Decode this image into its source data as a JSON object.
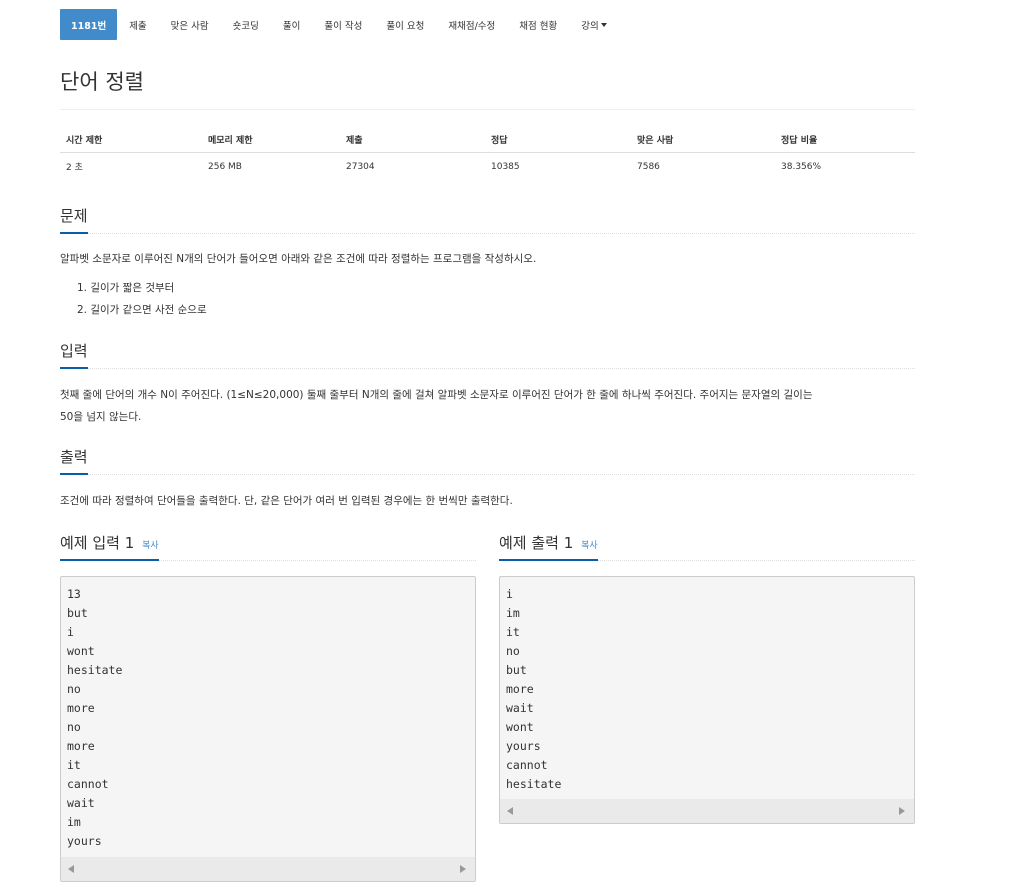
{
  "nav": {
    "items": [
      "1181번",
      "제출",
      "맞은 사람",
      "숏코딩",
      "풀이",
      "풀이 작성",
      "풀이 요청",
      "재채점/수정",
      "채점 현황",
      "강의"
    ]
  },
  "problem": {
    "title": "단어 정렬"
  },
  "stats": {
    "headers": [
      "시간 제한",
      "메모리 제한",
      "제출",
      "정답",
      "맞은 사람",
      "정답 비율"
    ],
    "values": [
      "2 초",
      "256 MB",
      "27304",
      "10385",
      "7586",
      "38.356%"
    ]
  },
  "sections": {
    "description_title": "문제",
    "description_text": "알파벳 소문자로 이루어진 N개의 단어가 들어오면 아래와 같은 조건에 따라 정렬하는 프로그램을 작성하시오.",
    "description_list": [
      "1. 길이가 짧은 것부터",
      "2. 길이가 같으면 사전 순으로"
    ],
    "input_title": "입력",
    "input_text_1": "첫째 줄에 단어의 개수 N이 주어진다. (1≤N≤20,000) 둘째 줄부터 N개의 줄에 걸쳐 알파벳 소문자로 이루어진 단어가 한 줄에 하나씩 주어진다. 주어지는 문자열의 길이는",
    "input_text_2": "50을 넘지 않는다.",
    "output_title": "출력",
    "output_text": "조건에 따라 정렬하여 단어들을 출력한다. 단, 같은 단어가 여러 번 입력된 경우에는 한 번씩만 출력한다."
  },
  "samples": {
    "input_title": "예제 입력 1",
    "output_title": "예제 출력 1",
    "copy_label": "복사",
    "input_lines": [
      "13",
      "but",
      "i",
      "wont",
      "hesitate",
      "no",
      "more",
      "no",
      "more",
      "it",
      "cannot",
      "wait",
      "im",
      "yours"
    ],
    "output_lines": [
      "i",
      "im",
      "it",
      "no",
      "but",
      "more",
      "wait",
      "wont",
      "yours",
      "cannot",
      "hesitate"
    ]
  },
  "colors": {
    "accent": "#428bca",
    "underline": "#0a5ea8"
  }
}
